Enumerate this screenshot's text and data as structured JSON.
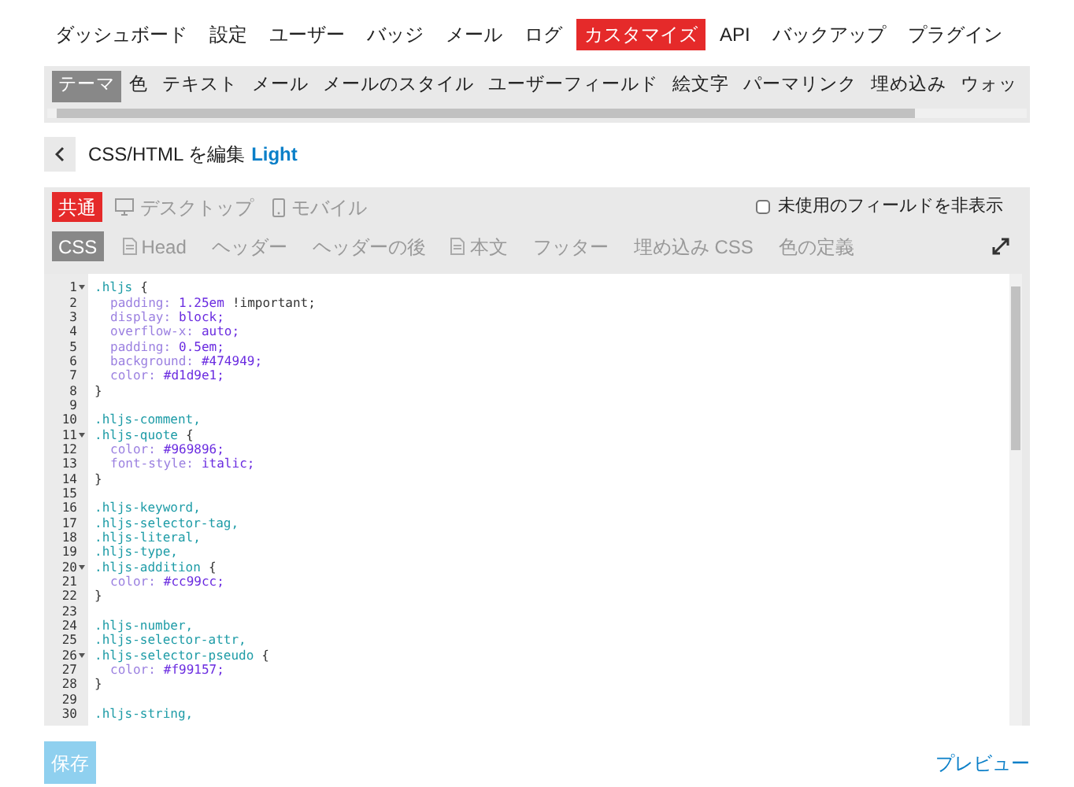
{
  "main_nav": [
    {
      "label": "ダッシュボード",
      "selected": false
    },
    {
      "label": "設定",
      "selected": false
    },
    {
      "label": "ユーザー",
      "selected": false
    },
    {
      "label": "バッジ",
      "selected": false
    },
    {
      "label": "メール",
      "selected": false
    },
    {
      "label": "ログ",
      "selected": false
    },
    {
      "label": "カスタマイズ",
      "selected": true
    },
    {
      "label": "API",
      "selected": false
    },
    {
      "label": "バックアップ",
      "selected": false
    },
    {
      "label": "プラグイン",
      "selected": false
    }
  ],
  "sub_nav": [
    {
      "label": "テーマ",
      "selected": true
    },
    {
      "label": "色",
      "selected": false
    },
    {
      "label": "テキスト",
      "selected": false
    },
    {
      "label": "メール",
      "selected": false
    },
    {
      "label": "メールのスタイル",
      "selected": false
    },
    {
      "label": "ユーザーフィールド",
      "selected": false
    },
    {
      "label": "絵文字",
      "selected": false
    },
    {
      "label": "パーマリンク",
      "selected": false
    },
    {
      "label": "埋め込み",
      "selected": false
    },
    {
      "label": "ウォッ",
      "selected": false
    }
  ],
  "header": {
    "title": "CSS/HTML を編集",
    "theme": "Light"
  },
  "targets": [
    {
      "label": "共通",
      "kind": "plain",
      "selected": true
    },
    {
      "label": "デスクトップ",
      "kind": "monitor",
      "selected": false
    },
    {
      "label": "モバイル",
      "kind": "phone",
      "selected": false
    }
  ],
  "hide_unused": {
    "label": "未使用のフィールドを非表示",
    "checked": false
  },
  "sections": [
    {
      "label": "CSS",
      "kind": "plain",
      "selected": true
    },
    {
      "label": "Head",
      "kind": "file",
      "selected": false
    },
    {
      "label": "ヘッダー",
      "kind": "plain",
      "selected": false
    },
    {
      "label": "ヘッダーの後",
      "kind": "plain",
      "selected": false
    },
    {
      "label": "本文",
      "kind": "file",
      "selected": false
    },
    {
      "label": "フッター",
      "kind": "plain",
      "selected": false
    },
    {
      "label": "埋め込み CSS",
      "kind": "plain",
      "selected": false
    },
    {
      "label": "色の定義",
      "kind": "plain",
      "selected": false
    }
  ],
  "code_lines": [
    {
      "number": "1",
      "fold": true,
      "tokens": [
        {
          "kind": "selector",
          "text": ".hljs"
        },
        {
          "kind": "punct",
          "text": "{"
        }
      ]
    },
    {
      "number": "2",
      "fold": false,
      "tokens": [
        {
          "kind": "property",
          "text": "padding:"
        },
        {
          "kind": "value",
          "text": "1.25em"
        },
        {
          "kind": "plain",
          "text": "!important;"
        }
      ]
    },
    {
      "number": "3",
      "fold": false,
      "tokens": [
        {
          "kind": "property",
          "text": "display:"
        },
        {
          "kind": "value",
          "text": "block;"
        }
      ]
    },
    {
      "number": "4",
      "fold": false,
      "tokens": [
        {
          "kind": "property",
          "text": "overflow-x:"
        },
        {
          "kind": "value",
          "text": "auto;"
        }
      ]
    },
    {
      "number": "5",
      "fold": false,
      "tokens": [
        {
          "kind": "property",
          "text": "padding:"
        },
        {
          "kind": "value",
          "text": "0.5em;"
        }
      ]
    },
    {
      "number": "6",
      "fold": false,
      "tokens": [
        {
          "kind": "property",
          "text": "background:"
        },
        {
          "kind": "value",
          "text": "#474949;"
        }
      ]
    },
    {
      "number": "7",
      "fold": false,
      "tokens": [
        {
          "kind": "property",
          "text": "color:"
        },
        {
          "kind": "value",
          "text": "#d1d9e1;"
        }
      ]
    },
    {
      "number": "8",
      "fold": false,
      "tokens": [
        {
          "kind": "punct",
          "text": "}"
        }
      ]
    },
    {
      "number": "9",
      "fold": false
    },
    {
      "number": "10",
      "fold": false,
      "tokens": [
        {
          "kind": "selector",
          "text": ".hljs-comment,"
        }
      ]
    },
    {
      "number": "11",
      "fold": true,
      "tokens": [
        {
          "kind": "selector",
          "text": ".hljs-quote"
        },
        {
          "kind": "punct",
          "text": "{"
        }
      ]
    },
    {
      "number": "12",
      "fold": false,
      "tokens": [
        {
          "kind": "property",
          "text": "color:"
        },
        {
          "kind": "value",
          "text": "#969896;"
        }
      ]
    },
    {
      "number": "13",
      "fold": false,
      "tokens": [
        {
          "kind": "property",
          "text": "font-style:"
        },
        {
          "kind": "value",
          "text": "italic;"
        }
      ]
    },
    {
      "number": "14",
      "fold": false,
      "tokens": [
        {
          "kind": "punct",
          "text": "}"
        }
      ]
    },
    {
      "number": "15",
      "fold": false
    },
    {
      "number": "16",
      "fold": false,
      "tokens": [
        {
          "kind": "selector",
          "text": ".hljs-keyword,"
        }
      ]
    },
    {
      "number": "17",
      "fold": false,
      "tokens": [
        {
          "kind": "selector",
          "text": ".hljs-selector-tag,"
        }
      ]
    },
    {
      "number": "18",
      "fold": false,
      "tokens": [
        {
          "kind": "selector",
          "text": ".hljs-literal,"
        }
      ]
    },
    {
      "number": "19",
      "fold": false,
      "tokens": [
        {
          "kind": "selector",
          "text": ".hljs-type,"
        }
      ]
    },
    {
      "number": "20",
      "fold": true,
      "tokens": [
        {
          "kind": "selector",
          "text": ".hljs-addition"
        },
        {
          "kind": "punct",
          "text": "{"
        }
      ]
    },
    {
      "number": "21",
      "fold": false,
      "tokens": [
        {
          "kind": "property",
          "text": "color:"
        },
        {
          "kind": "value",
          "text": "#cc99cc;"
        }
      ]
    },
    {
      "number": "22",
      "fold": false,
      "tokens": [
        {
          "kind": "punct",
          "text": "}"
        }
      ]
    },
    {
      "number": "23",
      "fold": false
    },
    {
      "number": "24",
      "fold": false,
      "tokens": [
        {
          "kind": "selector",
          "text": ".hljs-number,"
        }
      ]
    },
    {
      "number": "25",
      "fold": false,
      "tokens": [
        {
          "kind": "selector",
          "text": ".hljs-selector-attr,"
        }
      ]
    },
    {
      "number": "26",
      "fold": true,
      "tokens": [
        {
          "kind": "selector",
          "text": ".hljs-selector-pseudo"
        },
        {
          "kind": "punct",
          "text": "{"
        }
      ]
    },
    {
      "number": "27",
      "fold": false,
      "tokens": [
        {
          "kind": "property",
          "text": "color:"
        },
        {
          "kind": "value",
          "text": "#f99157;"
        }
      ]
    },
    {
      "number": "28",
      "fold": false,
      "tokens": [
        {
          "kind": "punct",
          "text": "}"
        }
      ]
    },
    {
      "number": "29",
      "fold": false
    },
    {
      "number": "30",
      "fold": false,
      "tokens": [
        {
          "kind": "selector",
          "text": ".hljs-string,"
        }
      ]
    }
  ],
  "save_button": "保存",
  "preview_link": "プレビュー"
}
